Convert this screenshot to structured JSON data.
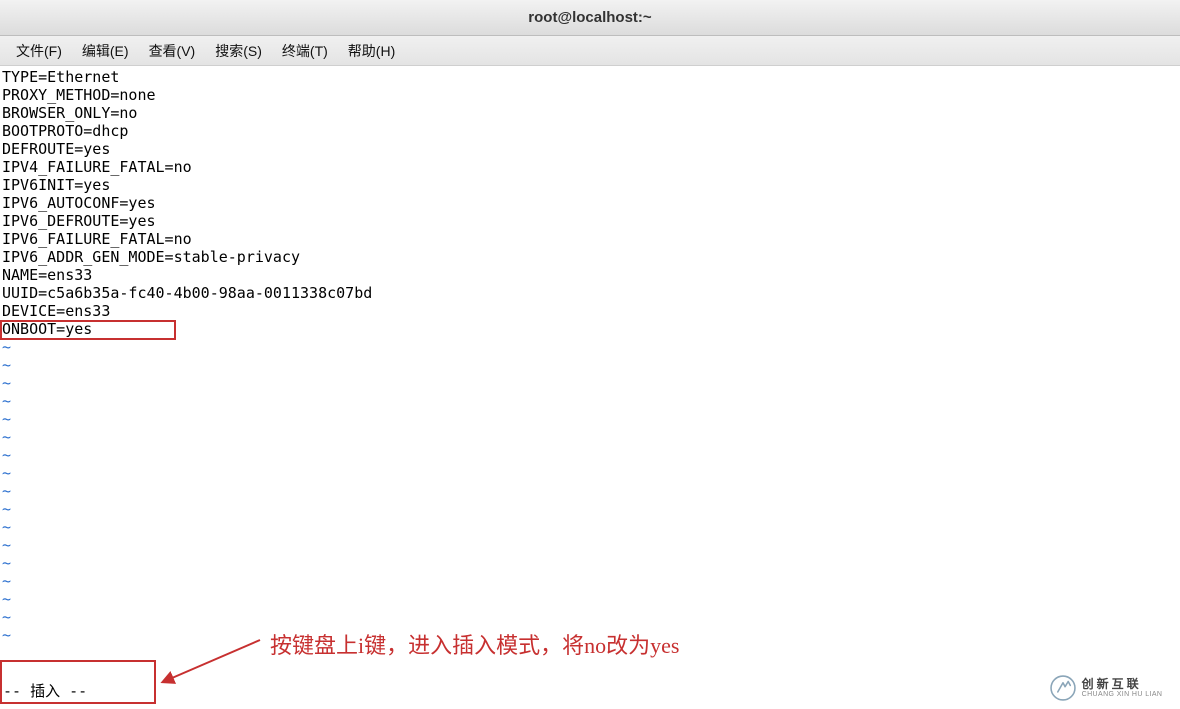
{
  "title": "root@localhost:~",
  "menu": {
    "file": "文件(F)",
    "edit": "编辑(E)",
    "view": "查看(V)",
    "search": "搜索(S)",
    "term": "终端(T)",
    "help": "帮助(H)"
  },
  "config_lines": [
    "TYPE=Ethernet",
    "PROXY_METHOD=none",
    "BROWSER_ONLY=no",
    "BOOTPROTO=dhcp",
    "DEFROUTE=yes",
    "IPV4_FAILURE_FATAL=no",
    "IPV6INIT=yes",
    "IPV6_AUTOCONF=yes",
    "IPV6_DEFROUTE=yes",
    "IPV6_FAILURE_FATAL=no",
    "IPV6_ADDR_GEN_MODE=stable-privacy",
    "NAME=ens33",
    "UUID=c5a6b35a-fc40-4b00-98aa-0011338c07bd",
    "DEVICE=ens33",
    "ONBOOT=yes"
  ],
  "insert_mode_text": "-- 插入 --",
  "annotation_text": "按键盘上i键，进入插入模式，将no改为yes",
  "tilde_count": 17,
  "watermark": {
    "cn": "创新互联",
    "en": "CHUANG XIN HU LIAN"
  }
}
